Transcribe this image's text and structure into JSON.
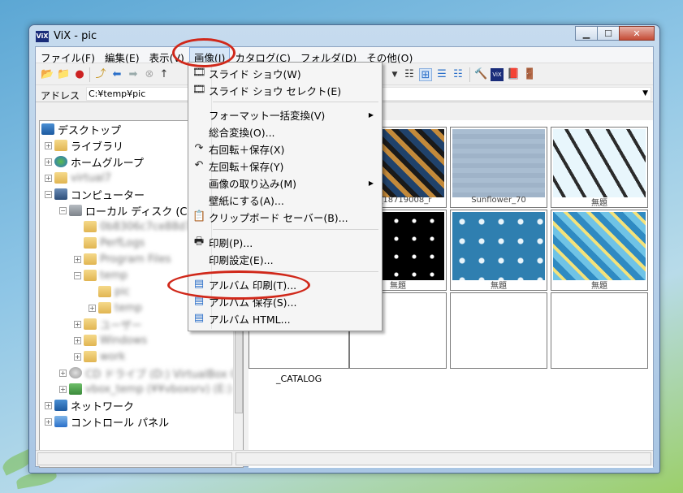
{
  "window": {
    "title": "ViX - pic",
    "app_icon": "ViX"
  },
  "titlebar_buttons": {
    "minimize": "▁",
    "maximize": "☐",
    "close": "✕"
  },
  "menubar": [
    "ファイル(F)",
    "編集(E)",
    "表示(V)",
    "画像(I)",
    "カタログ(C)",
    "フォルダ(D)",
    "その他(O)"
  ],
  "address": {
    "label": "アドレス",
    "value": "C:¥temp¥pic"
  },
  "tree": {
    "desktop": "デスクトップ",
    "library": "ライブラリ",
    "homegroup": "ホームグループ",
    "user_blurred": "virtual7",
    "computer": "コンピューター",
    "local_disk": "ローカル ディスク (C:",
    "blur1": "0b8306c7ce88d71",
    "perflogs": "PerfLogs",
    "program_files": "Program Files",
    "temp": "temp",
    "pic": "pic",
    "temp2": "temp",
    "users": "ユーザー",
    "windows": "Windows",
    "work": "work",
    "cd_drive": "CD ドライブ (D:) VirtualBox G",
    "network_drive": "vbox_temp (¥¥vboxsrv) (E:)",
    "network": "ネットワーク",
    "control_panel": "コントロール パネル"
  },
  "dropdown": {
    "items": [
      "スライド ショウ(W)",
      "スライド ショウ セレクト(E)",
      "フォーマット一括変換(V)",
      "総合変換(O)...",
      "右回転＋保存(X)",
      "左回転＋保存(Y)",
      "画像の取り込み(M)",
      "壁紙にする(A)...",
      "クリップボード セーバー(B)...",
      "印刷(P)...",
      "印刷設定(E)...",
      "アルバム 印刷(T)...",
      "アルバム 保存(S)...",
      "アルバム HTML..."
    ]
  },
  "thumbnails": {
    "labels": [
      "_98_18719008_r",
      "Sunflower_70",
      "無題",
      "無題",
      "無題",
      "無題"
    ],
    "catalog": "_CATALOG"
  },
  "colors": {
    "annotation": "#d0281a",
    "menu_highlight": "#d7e6f7"
  }
}
